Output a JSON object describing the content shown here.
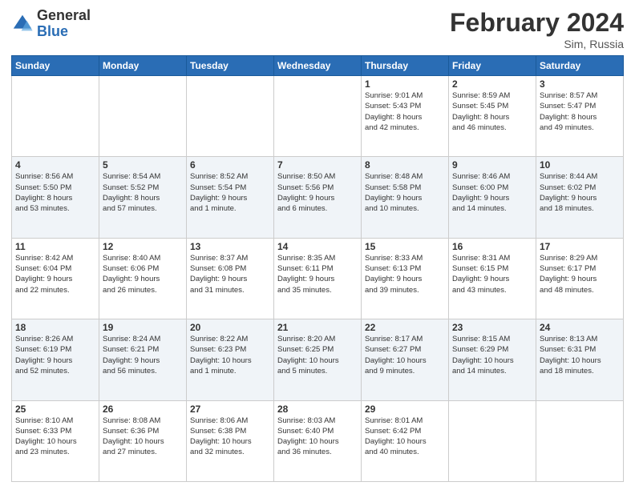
{
  "header": {
    "logo_general": "General",
    "logo_blue": "Blue",
    "month_title": "February 2024",
    "location": "Sim, Russia"
  },
  "weekdays": [
    "Sunday",
    "Monday",
    "Tuesday",
    "Wednesday",
    "Thursday",
    "Friday",
    "Saturday"
  ],
  "weeks": [
    [
      {
        "day": "",
        "info": ""
      },
      {
        "day": "",
        "info": ""
      },
      {
        "day": "",
        "info": ""
      },
      {
        "day": "",
        "info": ""
      },
      {
        "day": "1",
        "info": "Sunrise: 9:01 AM\nSunset: 5:43 PM\nDaylight: 8 hours\nand 42 minutes."
      },
      {
        "day": "2",
        "info": "Sunrise: 8:59 AM\nSunset: 5:45 PM\nDaylight: 8 hours\nand 46 minutes."
      },
      {
        "day": "3",
        "info": "Sunrise: 8:57 AM\nSunset: 5:47 PM\nDaylight: 8 hours\nand 49 minutes."
      }
    ],
    [
      {
        "day": "4",
        "info": "Sunrise: 8:56 AM\nSunset: 5:50 PM\nDaylight: 8 hours\nand 53 minutes."
      },
      {
        "day": "5",
        "info": "Sunrise: 8:54 AM\nSunset: 5:52 PM\nDaylight: 8 hours\nand 57 minutes."
      },
      {
        "day": "6",
        "info": "Sunrise: 8:52 AM\nSunset: 5:54 PM\nDaylight: 9 hours\nand 1 minute."
      },
      {
        "day": "7",
        "info": "Sunrise: 8:50 AM\nSunset: 5:56 PM\nDaylight: 9 hours\nand 6 minutes."
      },
      {
        "day": "8",
        "info": "Sunrise: 8:48 AM\nSunset: 5:58 PM\nDaylight: 9 hours\nand 10 minutes."
      },
      {
        "day": "9",
        "info": "Sunrise: 8:46 AM\nSunset: 6:00 PM\nDaylight: 9 hours\nand 14 minutes."
      },
      {
        "day": "10",
        "info": "Sunrise: 8:44 AM\nSunset: 6:02 PM\nDaylight: 9 hours\nand 18 minutes."
      }
    ],
    [
      {
        "day": "11",
        "info": "Sunrise: 8:42 AM\nSunset: 6:04 PM\nDaylight: 9 hours\nand 22 minutes."
      },
      {
        "day": "12",
        "info": "Sunrise: 8:40 AM\nSunset: 6:06 PM\nDaylight: 9 hours\nand 26 minutes."
      },
      {
        "day": "13",
        "info": "Sunrise: 8:37 AM\nSunset: 6:08 PM\nDaylight: 9 hours\nand 31 minutes."
      },
      {
        "day": "14",
        "info": "Sunrise: 8:35 AM\nSunset: 6:11 PM\nDaylight: 9 hours\nand 35 minutes."
      },
      {
        "day": "15",
        "info": "Sunrise: 8:33 AM\nSunset: 6:13 PM\nDaylight: 9 hours\nand 39 minutes."
      },
      {
        "day": "16",
        "info": "Sunrise: 8:31 AM\nSunset: 6:15 PM\nDaylight: 9 hours\nand 43 minutes."
      },
      {
        "day": "17",
        "info": "Sunrise: 8:29 AM\nSunset: 6:17 PM\nDaylight: 9 hours\nand 48 minutes."
      }
    ],
    [
      {
        "day": "18",
        "info": "Sunrise: 8:26 AM\nSunset: 6:19 PM\nDaylight: 9 hours\nand 52 minutes."
      },
      {
        "day": "19",
        "info": "Sunrise: 8:24 AM\nSunset: 6:21 PM\nDaylight: 9 hours\nand 56 minutes."
      },
      {
        "day": "20",
        "info": "Sunrise: 8:22 AM\nSunset: 6:23 PM\nDaylight: 10 hours\nand 1 minute."
      },
      {
        "day": "21",
        "info": "Sunrise: 8:20 AM\nSunset: 6:25 PM\nDaylight: 10 hours\nand 5 minutes."
      },
      {
        "day": "22",
        "info": "Sunrise: 8:17 AM\nSunset: 6:27 PM\nDaylight: 10 hours\nand 9 minutes."
      },
      {
        "day": "23",
        "info": "Sunrise: 8:15 AM\nSunset: 6:29 PM\nDaylight: 10 hours\nand 14 minutes."
      },
      {
        "day": "24",
        "info": "Sunrise: 8:13 AM\nSunset: 6:31 PM\nDaylight: 10 hours\nand 18 minutes."
      }
    ],
    [
      {
        "day": "25",
        "info": "Sunrise: 8:10 AM\nSunset: 6:33 PM\nDaylight: 10 hours\nand 23 minutes."
      },
      {
        "day": "26",
        "info": "Sunrise: 8:08 AM\nSunset: 6:36 PM\nDaylight: 10 hours\nand 27 minutes."
      },
      {
        "day": "27",
        "info": "Sunrise: 8:06 AM\nSunset: 6:38 PM\nDaylight: 10 hours\nand 32 minutes."
      },
      {
        "day": "28",
        "info": "Sunrise: 8:03 AM\nSunset: 6:40 PM\nDaylight: 10 hours\nand 36 minutes."
      },
      {
        "day": "29",
        "info": "Sunrise: 8:01 AM\nSunset: 6:42 PM\nDaylight: 10 hours\nand 40 minutes."
      },
      {
        "day": "",
        "info": ""
      },
      {
        "day": "",
        "info": ""
      }
    ]
  ]
}
